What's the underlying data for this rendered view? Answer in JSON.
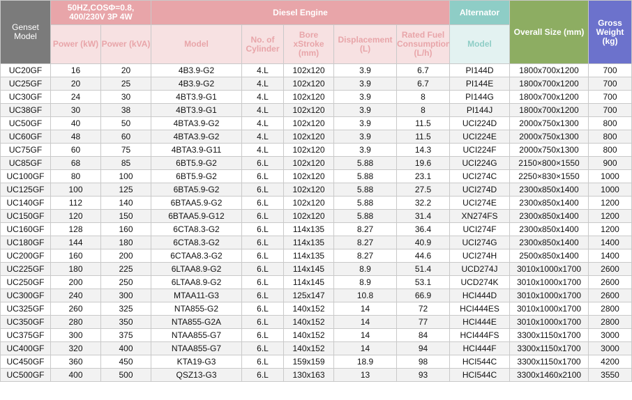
{
  "header": {
    "genset_model": "Genset Model",
    "freq_note": "50HZ,COSΦ=0.8, 400/230V 3P 4W",
    "diesel_engine": "Diesel Engine",
    "alternator": "Alternator",
    "overall_size": "Overall Size (mm)",
    "gross_weight": "Gross Weight (kg)",
    "power_kw": "Power (kW)",
    "power_kva": "Power (kVA)",
    "engine_model": "Model",
    "cylinders": "No. of Cylinder",
    "bore_stroke": "Bore xStroke (mm)",
    "displacement": "Displacement (L)",
    "fuel": "Rated Fuel Consumption (L/h)",
    "alt_model": "Model"
  },
  "rows": [
    [
      "UC20GF",
      "16",
      "20",
      "4B3.9-G2",
      "4.L",
      "102x120",
      "3.9",
      "6.7",
      "PI144D",
      "1800x700x1200",
      "700"
    ],
    [
      "UC25GF",
      "20",
      "25",
      "4B3.9-G2",
      "4.L",
      "102x120",
      "3.9",
      "6.7",
      "PI144E",
      "1800x700x1200",
      "700"
    ],
    [
      "UC30GF",
      "24",
      "30",
      "4BT3.9-G1",
      "4.L",
      "102x120",
      "3.9",
      "8",
      "PI144G",
      "1800x700x1200",
      "700"
    ],
    [
      "UC38GF",
      "30",
      "38",
      "4BT3.9-G1",
      "4.L",
      "102x120",
      "3.9",
      "8",
      "PI144J",
      "1800x700x1200",
      "700"
    ],
    [
      "UC50GF",
      "40",
      "50",
      "4BTA3.9-G2",
      "4.L",
      "102x120",
      "3.9",
      "11.5",
      "UCI224D",
      "2000x750x1300",
      "800"
    ],
    [
      "UC60GF",
      "48",
      "60",
      "4BTA3.9-G2",
      "4.L",
      "102x120",
      "3.9",
      "11.5",
      "UCI224E",
      "2000x750x1300",
      "800"
    ],
    [
      "UC75GF",
      "60",
      "75",
      "4BTA3.9-G11",
      "4.L",
      "102x120",
      "3.9",
      "14.3",
      "UCI224F",
      "2000x750x1300",
      "800"
    ],
    [
      "UC85GF",
      "68",
      "85",
      "6BT5.9-G2",
      "6.L",
      "102x120",
      "5.88",
      "19.6",
      "UCI224G",
      "2150×800×1550",
      "900"
    ],
    [
      "UC100GF",
      "80",
      "100",
      "6BT5.9-G2",
      "6.L",
      "102x120",
      "5.88",
      "23.1",
      "UCI274C",
      "2250×830×1550",
      "1000"
    ],
    [
      "UC125GF",
      "100",
      "125",
      "6BTA5.9-G2",
      "6.L",
      "102x120",
      "5.88",
      "27.5",
      "UCI274D",
      "2300x850x1400",
      "1000"
    ],
    [
      "UC140GF",
      "112",
      "140",
      "6BTAA5.9-G2",
      "6.L",
      "102x120",
      "5.88",
      "32.2",
      "UCI274E",
      "2300x850x1400",
      "1200"
    ],
    [
      "UC150GF",
      "120",
      "150",
      "6BTAA5.9-G12",
      "6.L",
      "102x120",
      "5.88",
      "31.4",
      "XN274FS",
      "2300x850x1400",
      "1200"
    ],
    [
      "UC160GF",
      "128",
      "160",
      "6CTA8.3-G2",
      "6.L",
      "114x135",
      "8.27",
      "36.4",
      "UCI274F",
      "2300x850x1400",
      "1200"
    ],
    [
      "UC180GF",
      "144",
      "180",
      "6CTA8.3-G2",
      "6.L",
      "114x135",
      "8.27",
      "40.9",
      "UCI274G",
      "2300x850x1400",
      "1400"
    ],
    [
      "UC200GF",
      "160",
      "200",
      "6CTAA8.3-G2",
      "6.L",
      "114x135",
      "8.27",
      "44.6",
      "UCI274H",
      "2500x850x1400",
      "1400"
    ],
    [
      "UC225GF",
      "180",
      "225",
      "6LTAA8.9-G2",
      "6.L",
      "114x145",
      "8.9",
      "51.4",
      "UCD274J",
      "3010x1000x1700",
      "2600"
    ],
    [
      "UC250GF",
      "200",
      "250",
      "6LTAA8.9-G2",
      "6.L",
      "114x145",
      "8.9",
      "53.1",
      "UCD274K",
      "3010x1000x1700",
      "2600"
    ],
    [
      "UC300GF",
      "240",
      "300",
      "MTAA11-G3",
      "6.L",
      "125x147",
      "10.8",
      "66.9",
      "HCI444D",
      "3010x1000x1700",
      "2600"
    ],
    [
      "UC325GF",
      "260",
      "325",
      "NTA855-G2",
      "6.L",
      "140x152",
      "14",
      "72",
      "HCI444ES",
      "3010x1000x1700",
      "2800"
    ],
    [
      "UC350GF",
      "280",
      "350",
      "NTA855-G2A",
      "6.L",
      "140x152",
      "14",
      "77",
      "HCI444E",
      "3010x1000x1700",
      "2800"
    ],
    [
      "UC375GF",
      "300",
      "375",
      "NTAA855-G7",
      "6.L",
      "140x152",
      "14",
      "84",
      "HCI444FS",
      "3300x1150x1700",
      "3000"
    ],
    [
      "UC400GF",
      "320",
      "400",
      "NTAA855-G7",
      "6.L",
      "140x152",
      "14",
      "94",
      "HCI444F",
      "3300x1150x1700",
      "3000"
    ],
    [
      "UC450GF",
      "360",
      "450",
      "KTA19-G3",
      "6.L",
      "159x159",
      "18.9",
      "98",
      "HCI544C",
      "3300x1150x1700",
      "4200"
    ],
    [
      "UC500GF",
      "400",
      "500",
      "QSZ13-G3",
      "6.L",
      "130x163",
      "13",
      "93",
      "HCI544C",
      "3300x1460x2100",
      "3550"
    ]
  ]
}
